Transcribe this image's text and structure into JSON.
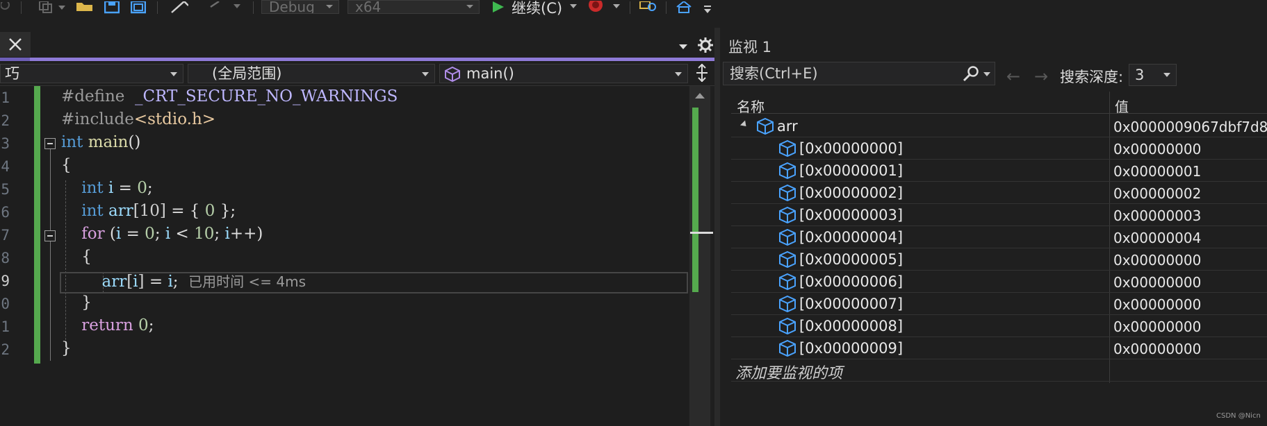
{
  "toolbar": {
    "config_value": "Debug",
    "platform_value": "x64",
    "continue_label": "继续(C)"
  },
  "editor": {
    "nav": {
      "project_partial": "巧",
      "scope": "(全局范围)",
      "member": "main()"
    },
    "line_numbers": [
      "1",
      "2",
      "3",
      "4",
      "5",
      "6",
      "7",
      "8",
      "9",
      "0",
      "1",
      "2"
    ],
    "lines": {
      "l1_directive": "#define",
      "l1_macro": "_CRT_SECURE_NO_WARNINGS",
      "l2_directive": "#include",
      "l2_header": "<stdio.h>",
      "l3_kw": "int",
      "l3_fn": "main",
      "l3_paren": "()",
      "l4": "{",
      "l5_kw": "int",
      "l5_var": "i",
      "l5_eq": " = ",
      "l5_num": "0",
      "l5_end": ";",
      "l6_kw": "int",
      "l6_var": "arr",
      "l6_idx": "[10]",
      "l6_rest": " = { ",
      "l6_num": "0",
      "l6_end": " };",
      "l7_kw": "for",
      "l7_open": " (",
      "l7_var1": "i",
      "l7_eq": " = ",
      "l7_num1": "0",
      "l7_semi1": "; ",
      "l7_var2": "i",
      "l7_lt": " < ",
      "l7_num2": "10",
      "l7_semi2": "; ",
      "l7_var3": "i",
      "l7_inc": "++)",
      "l8": "{",
      "l9_var": "arr",
      "l9_idx_open": "[",
      "l9_idx_var": "i",
      "l9_idx_close": "]",
      "l9_eq": " = ",
      "l9_var2": "i",
      "l9_end": ";",
      "l9_hint": "已用时间 <= 4ms",
      "l10": "}",
      "l11_kw": "return",
      "l11_num": " 0",
      "l11_end": ";",
      "l12": "}"
    }
  },
  "watch": {
    "title": "监视 1",
    "search_placeholder": "搜索(Ctrl+E)",
    "depth_label": "搜索深度:",
    "depth_value": "3",
    "col_name": "名称",
    "col_value": "值",
    "root": {
      "name": "arr",
      "value": "0x0000009067dbf7d8"
    },
    "items": [
      {
        "name": "[0x00000000]",
        "value": "0x00000000"
      },
      {
        "name": "[0x00000001]",
        "value": "0x00000001"
      },
      {
        "name": "[0x00000002]",
        "value": "0x00000002"
      },
      {
        "name": "[0x00000003]",
        "value": "0x00000003"
      },
      {
        "name": "[0x00000004]",
        "value": "0x00000004"
      },
      {
        "name": "[0x00000005]",
        "value": "0x00000000"
      },
      {
        "name": "[0x00000006]",
        "value": "0x00000000"
      },
      {
        "name": "[0x00000007]",
        "value": "0x00000000"
      },
      {
        "name": "[0x00000008]",
        "value": "0x00000000"
      },
      {
        "name": "[0x00000009]",
        "value": "0x00000000"
      }
    ],
    "add_item": "添加要监视的项"
  },
  "watermark": "CSDN @Nicn",
  "colors": {
    "accent_tab": "#8e7ad7",
    "change_bar": "#55a94e",
    "keyword": "#569cd6",
    "control": "#d8a0df",
    "continue_green": "#3fb950",
    "record_red": "#c92a2a"
  }
}
